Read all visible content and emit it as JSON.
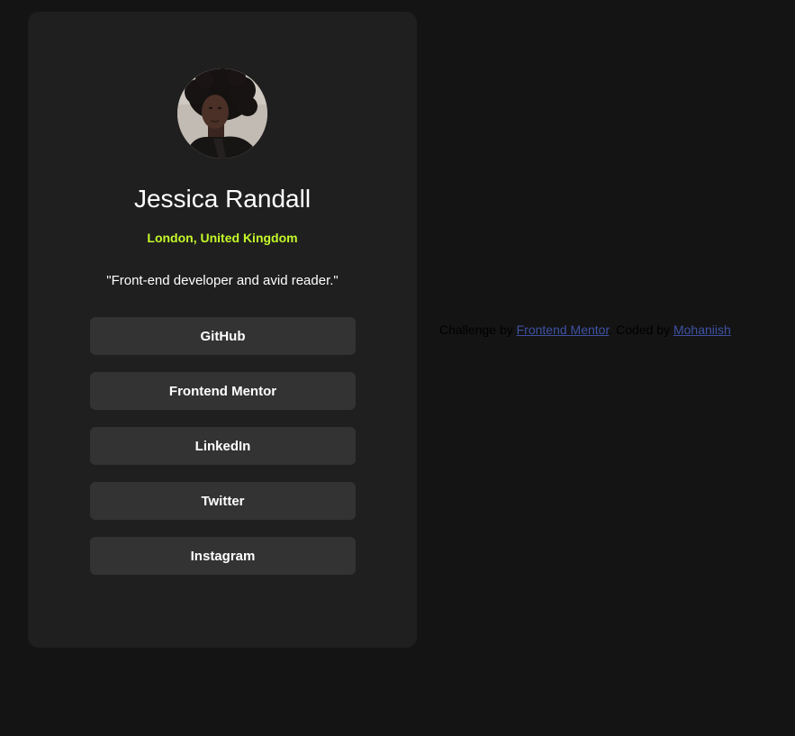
{
  "profile": {
    "name": "Jessica Randall",
    "location": "London, United Kingdom",
    "bio": "\"Front-end developer and avid reader.\""
  },
  "links": [
    {
      "label": "GitHub"
    },
    {
      "label": "Frontend Mentor"
    },
    {
      "label": "LinkedIn"
    },
    {
      "label": "Twitter"
    },
    {
      "label": "Instagram"
    }
  ],
  "attribution": {
    "prefix": "Challenge by ",
    "challenge_link": "Frontend Mentor",
    "middle": ". Coded by ",
    "author_link": "Mohaniish"
  },
  "colors": {
    "page_background": "#141414",
    "card_background": "#1f1f1f",
    "button_background": "#333333",
    "accent": "#c4f82a",
    "link": "#3e52a3"
  }
}
